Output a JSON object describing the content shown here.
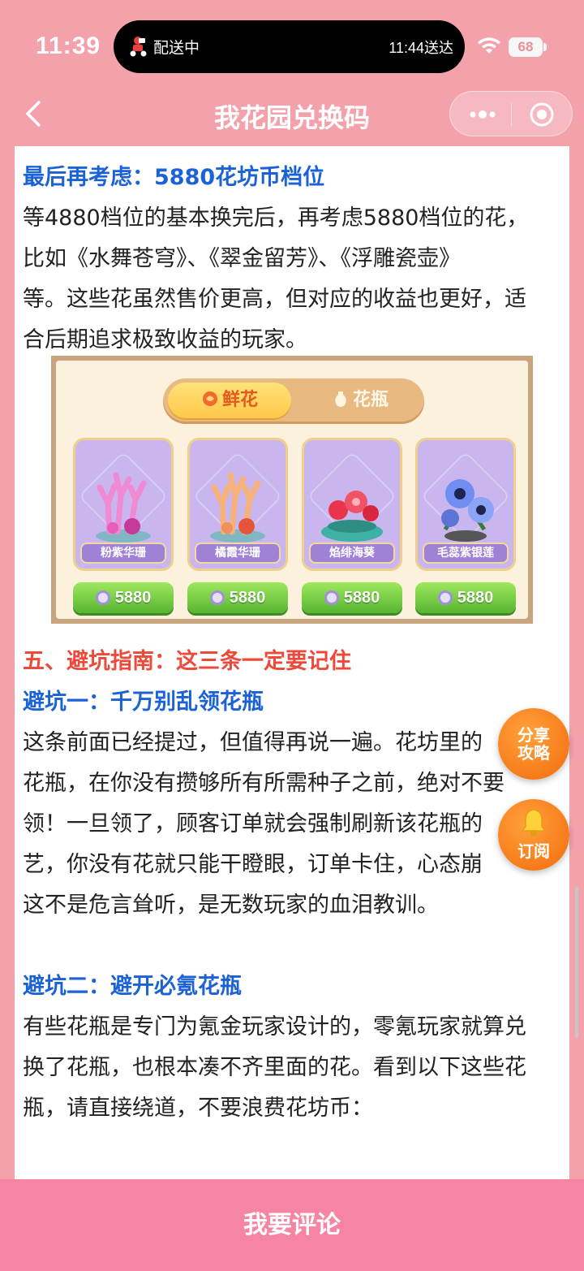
{
  "status_bar": {
    "time": "11:39",
    "delivery_status": "配送中",
    "delivery_eta": "11:44送达",
    "battery": "68"
  },
  "nav": {
    "title": "我花园兑换码"
  },
  "article": {
    "lines": [
      "最后再考虑：5880花坊币档位",
      "等4880档位的基本换完后，再考虑5880档位的花，",
      "比如《水舞苍穹》、《翠金留芳》、《浮雕瓷壶》",
      "等。这些花虽然售价更高，但对应的收益也更好，适",
      "合后期追求极致收益的玩家。",
      "五、避坑指南：这三条一定要记住",
      "避坑一：千万别乱领花瓶",
      "这条前面已经提过，但值得再说一遍。花坊里的",
      "花瓶，在你没有攒够所有所需种子之前，绝对不要",
      "领！一旦领了，顾客订单就会强制刷新该花瓶的",
      "艺，你没有花就只能干瞪眼，订单卡住，心态崩",
      "这不是危言耸听，是无数玩家的血泪教训。",
      "避坑二：避开必氪花瓶",
      "有些花瓶是专门为氪金玩家设计的，零氪玩家就算兑",
      "换了花瓶，也根本凑不齐里面的花。看到以下这些花",
      "瓶，请直接绕道，不要浪费花坊币："
    ]
  },
  "game_image": {
    "tabs": [
      "鲜花",
      "花瓶"
    ],
    "items": [
      {
        "name": "粉紫华珊",
        "price": "5880"
      },
      {
        "name": "橘霞华珊",
        "price": "5880"
      },
      {
        "name": "焰绯海葵",
        "price": "5880"
      },
      {
        "name": "毛蕊紫银莲",
        "price": "5880"
      }
    ]
  },
  "floating": {
    "share_line1": "分享",
    "share_line2": "攻略",
    "subscribe": "订阅"
  },
  "bottom": {
    "comment": "我要评论"
  },
  "colors": {
    "header_pink": "#f3a2ac",
    "bottom_pink": "#f585a3",
    "heading_blue": "#1b62d6",
    "heading_red": "#ee4a3a",
    "fab_orange": "#f46a0c"
  }
}
